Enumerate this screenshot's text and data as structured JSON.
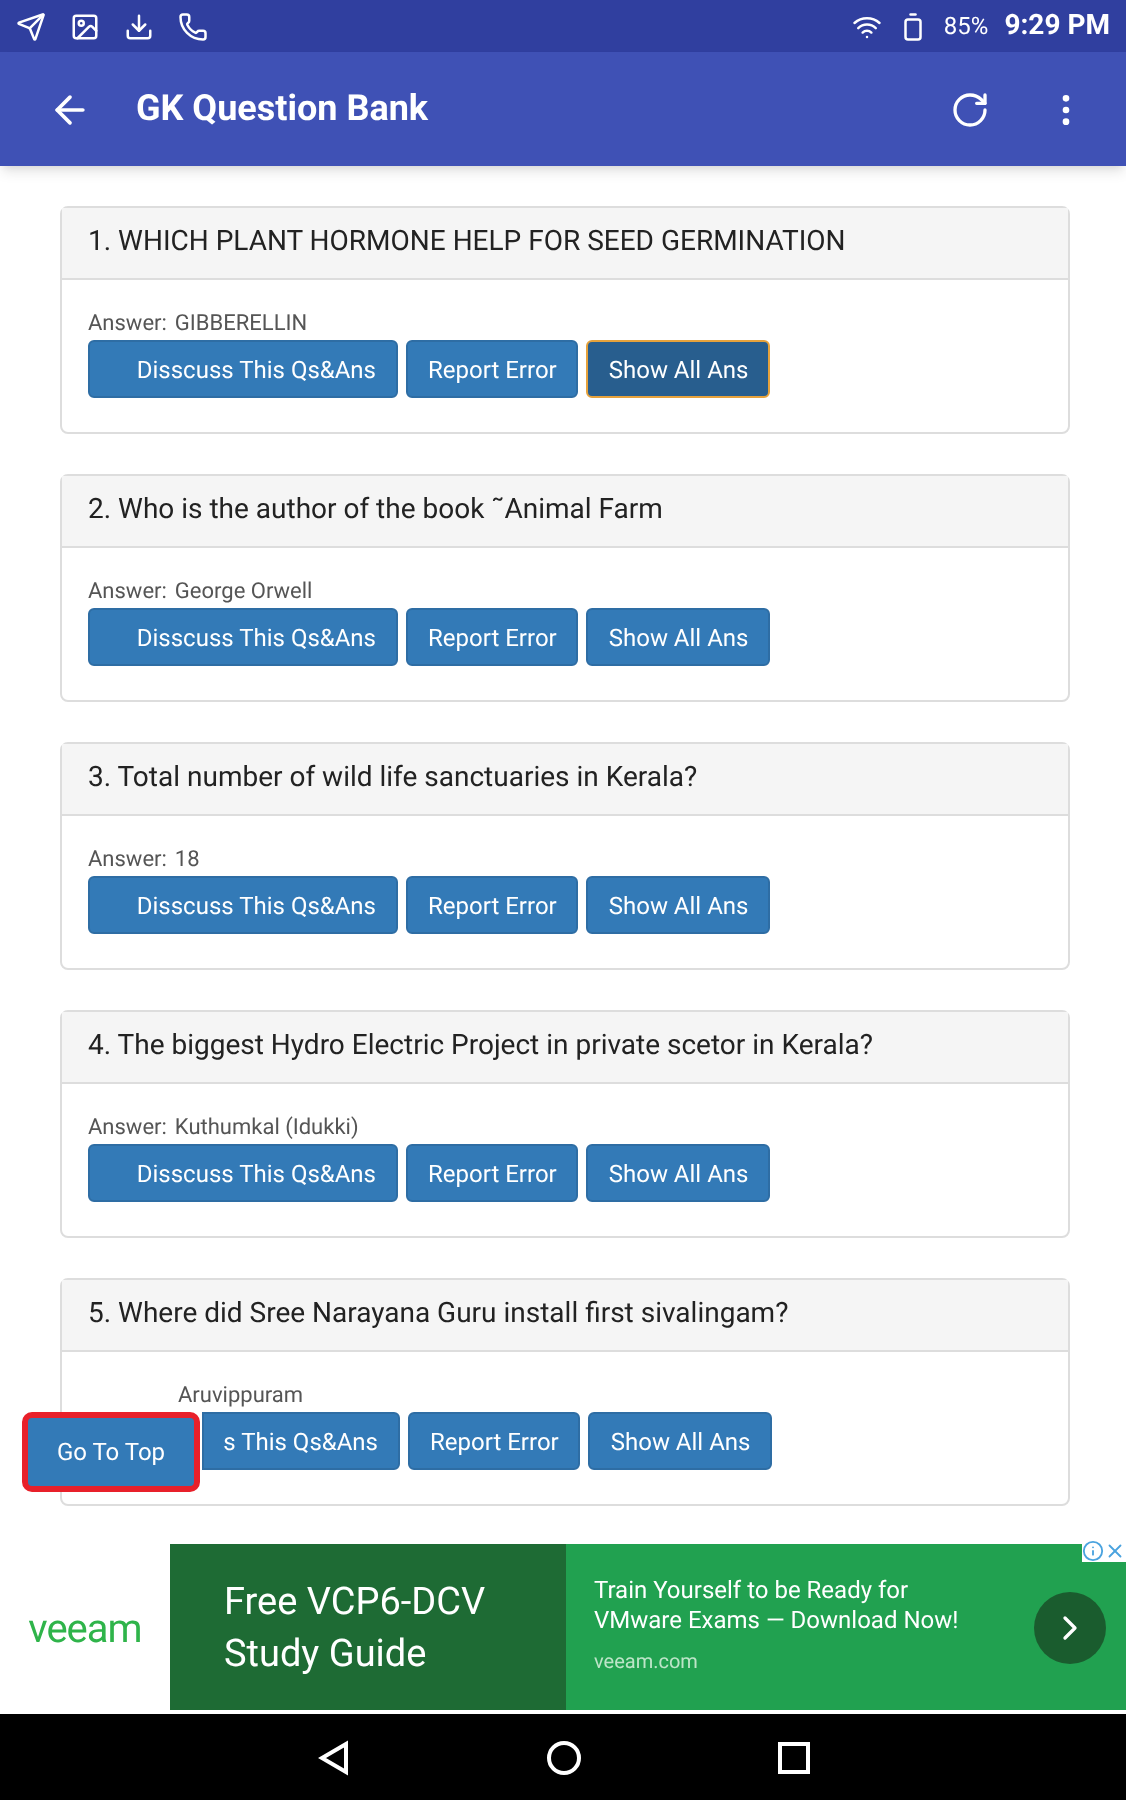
{
  "status_bar": {
    "battery": "85%",
    "time": "9:29 PM"
  },
  "app_bar": {
    "title": "GK Question Bank"
  },
  "questions": [
    {
      "question": "1. WHICH PLANT HORMONE HELP FOR SEED GERMINATION",
      "answer_label": "Answer:",
      "answer": "GIBBERELLIN",
      "buttons": [
        {
          "label": "Disscuss This Qs&Ans",
          "focused": false
        },
        {
          "label": "Report Error",
          "focused": false
        },
        {
          "label": "Show All Ans",
          "focused": true
        }
      ]
    },
    {
      "question": "2. Who is the author of the book ˜Animal Farm",
      "answer_label": "Answer:",
      "answer": "George Orwell",
      "buttons": [
        {
          "label": "Disscuss This Qs&Ans",
          "focused": false
        },
        {
          "label": "Report Error",
          "focused": false
        },
        {
          "label": "Show All Ans",
          "focused": false
        }
      ]
    },
    {
      "question": "3. Total number of wild life sanctuaries in Kerala?",
      "answer_label": "Answer:",
      "answer": "18",
      "buttons": [
        {
          "label": "Disscuss This Qs&Ans",
          "focused": false
        },
        {
          "label": "Report Error",
          "focused": false
        },
        {
          "label": "Show All Ans",
          "focused": false
        }
      ]
    },
    {
      "question": "4. The biggest Hydro Electric Project in private scetor in Kerala?",
      "answer_label": "Answer:",
      "answer": "Kuthumkal (Idukki)",
      "buttons": [
        {
          "label": "Disscuss This Qs&Ans",
          "focused": false
        },
        {
          "label": "Report Error",
          "focused": false
        },
        {
          "label": "Show All Ans",
          "focused": false
        }
      ]
    },
    {
      "question": "5. Where did Sree Narayana Guru install first sivalingam?",
      "answer": "Aruvippuram",
      "buttons": [
        {
          "label": "s This Qs&Ans",
          "focused": false
        },
        {
          "label": "Report Error",
          "focused": false
        },
        {
          "label": "Show All Ans",
          "focused": false
        }
      ]
    }
  ],
  "go_to_top": {
    "label": "Go To Top"
  },
  "ad": {
    "brand": "veeam",
    "headline": "Free VCP6-DCV Study Guide",
    "body": "Train Yourself to be Ready for VMware Exams — Download Now!",
    "url": "veeam.com"
  }
}
